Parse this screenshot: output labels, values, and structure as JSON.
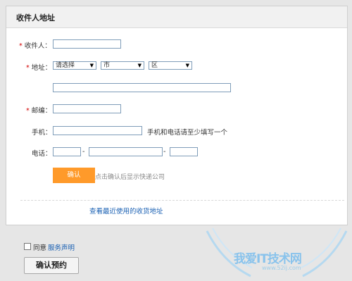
{
  "panel": {
    "title": "收件人地址"
  },
  "form": {
    "recipient_label": "收件人：",
    "address_label": "地址：",
    "province_select": "请选择",
    "city_select": "市",
    "district_select": "区",
    "zip_label": "邮编：",
    "mobile_label": "手机：",
    "mobile_hint": "手机和电话请至少填写一个",
    "phone_label": "电话：",
    "phone_sep1": "-",
    "phone_sep2": "-",
    "confirm_button": "确认",
    "confirm_hint": "点击确认后显示快递公司",
    "recent_link": "查看最近使用的收货地址"
  },
  "footer": {
    "agree_label": "同意",
    "service_link": "服务声明",
    "reserve_button": "确认预约"
  },
  "watermark": {
    "text": "我爱IT技术网",
    "url": "www.52ij.com"
  },
  "colors": {
    "accent": "#ff9a2a",
    "link": "#1a60b3",
    "required": "#d40000"
  }
}
